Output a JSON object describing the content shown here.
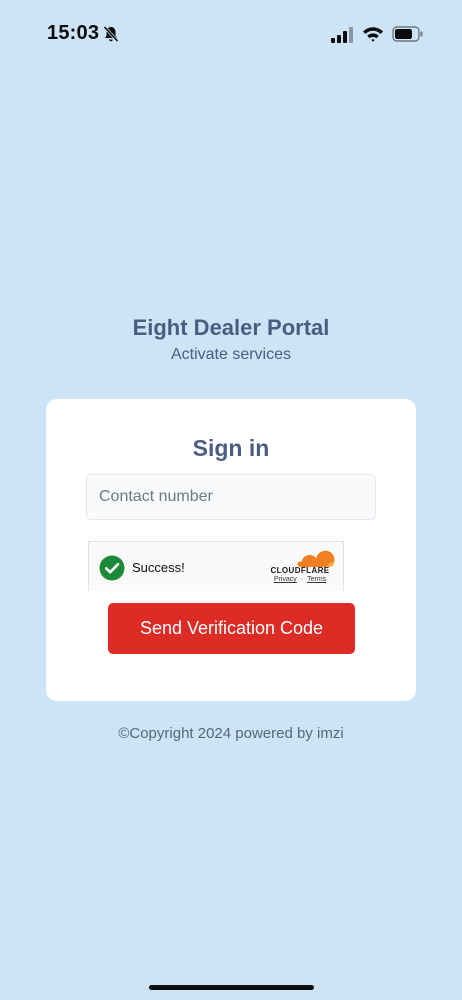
{
  "status_bar": {
    "time": "15:03",
    "icons": [
      "bell-slash-icon",
      "cellular-signal-icon",
      "wifi-icon",
      "battery-icon"
    ]
  },
  "brand": {
    "title": "Eight Dealer Portal",
    "subtitle": "Activate services"
  },
  "signin": {
    "title": "Sign in",
    "contact_placeholder": "Contact number",
    "contact_value": "",
    "captcha": {
      "status": "Success!",
      "provider": "CLOUDFLARE",
      "privacy_label": "Privacy",
      "separator": "·",
      "terms_label": "Terms"
    },
    "send_label": "Send Verification Code"
  },
  "footer": {
    "copyright": "©Copyright 2024 powered by imzi"
  },
  "colors": {
    "background": "#cde4f6",
    "heading": "#4a5c82",
    "primary_button": "#dd2b26",
    "success": "#1a8a3a",
    "cloudflare_orange": "#f38020"
  }
}
